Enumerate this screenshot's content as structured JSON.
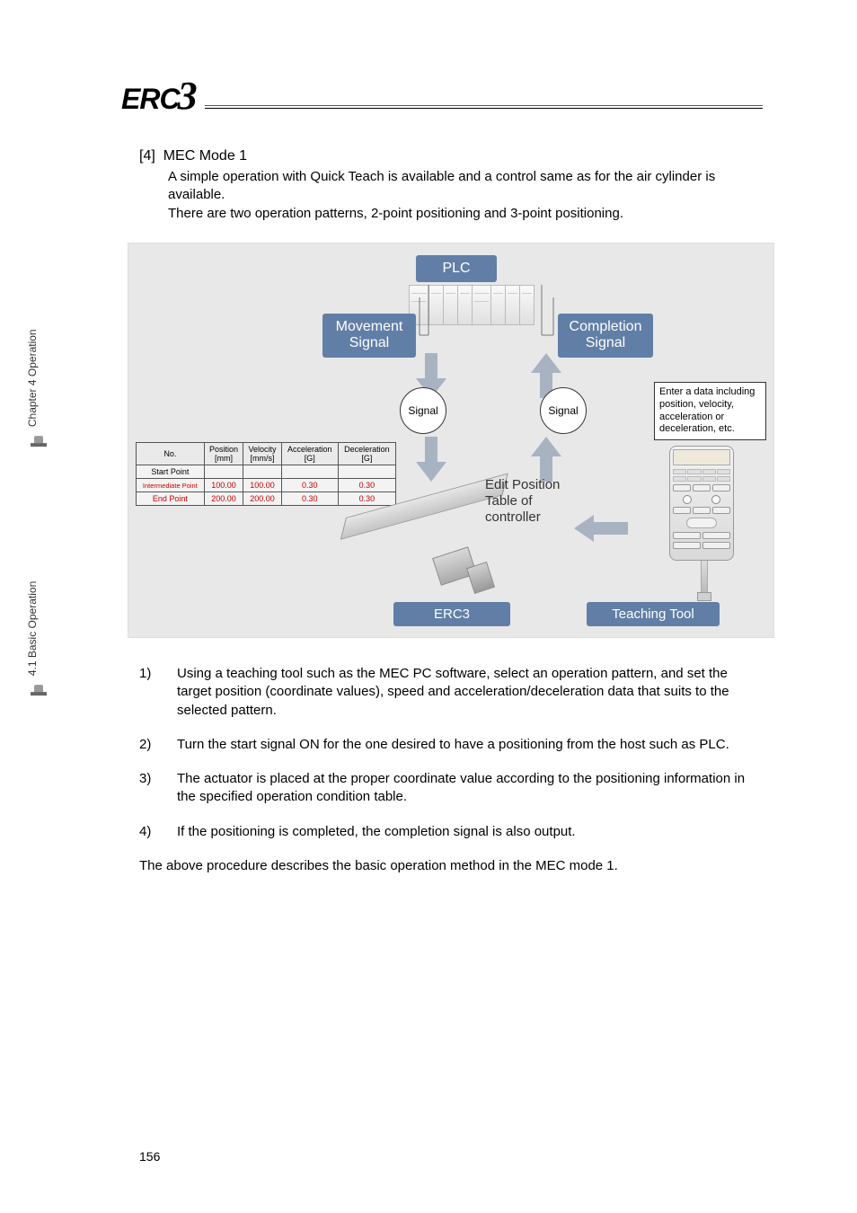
{
  "logo": {
    "prefix": "ERC",
    "suffix": "3"
  },
  "sidebar": {
    "tab1": "Chapter 4 Operation",
    "tab2": "4.1 Basic Operation"
  },
  "section": {
    "tag": "[4]",
    "title": "MEC Mode 1",
    "intro_line1": "A simple operation with Quick Teach is available and a control same as for the air cylinder is available.",
    "intro_line2": "There are two operation patterns, 2-point positioning and 3-point positioning."
  },
  "diagram": {
    "plc": "PLC",
    "move_sig_l1": "Movement",
    "move_sig_l2": "Signal",
    "comp_sig_l1": "Completion",
    "comp_sig_l2": "Signal",
    "signal": "Signal",
    "note": "Enter a data including position, velocity, acceleration or deceleration, etc.",
    "edit_l1": "Edit Position",
    "edit_l2": "Table of",
    "edit_l3": "controller",
    "erc3": "ERC3",
    "teach_tool": "Teaching Tool",
    "table": {
      "headers": [
        "No.",
        "Position\n[mm]",
        "Velocity\n[mm/s]",
        "Acceleration\n[G]",
        "Deceleration\n[G]"
      ],
      "rows": [
        {
          "label": "Start Point",
          "cells": [
            "",
            "",
            "",
            ""
          ],
          "red": false
        },
        {
          "label": "Intermediate Point",
          "cells": [
            "100.00",
            "100.00",
            "0.30",
            "0.30"
          ],
          "red": true
        },
        {
          "label": "End Point",
          "cells": [
            "200.00",
            "200.00",
            "0.30",
            "0.30"
          ],
          "red": true
        }
      ]
    }
  },
  "steps": [
    {
      "n": "1)",
      "t": "Using a teaching tool such as the MEC PC software, select an operation pattern, and set the target position (coordinate values), speed and acceleration/deceleration data that suits to the selected pattern."
    },
    {
      "n": "2)",
      "t": "Turn the start signal ON for the one desired to have a positioning from the host such as PLC."
    },
    {
      "n": "3)",
      "t": "The actuator is placed at the proper coordinate value according to the positioning information in the specified operation condition table."
    },
    {
      "n": "4)",
      "t": "If the positioning is completed, the completion signal is also output."
    }
  ],
  "closing": "The above procedure describes the basic operation method in the MEC mode 1.",
  "page_number": "156"
}
